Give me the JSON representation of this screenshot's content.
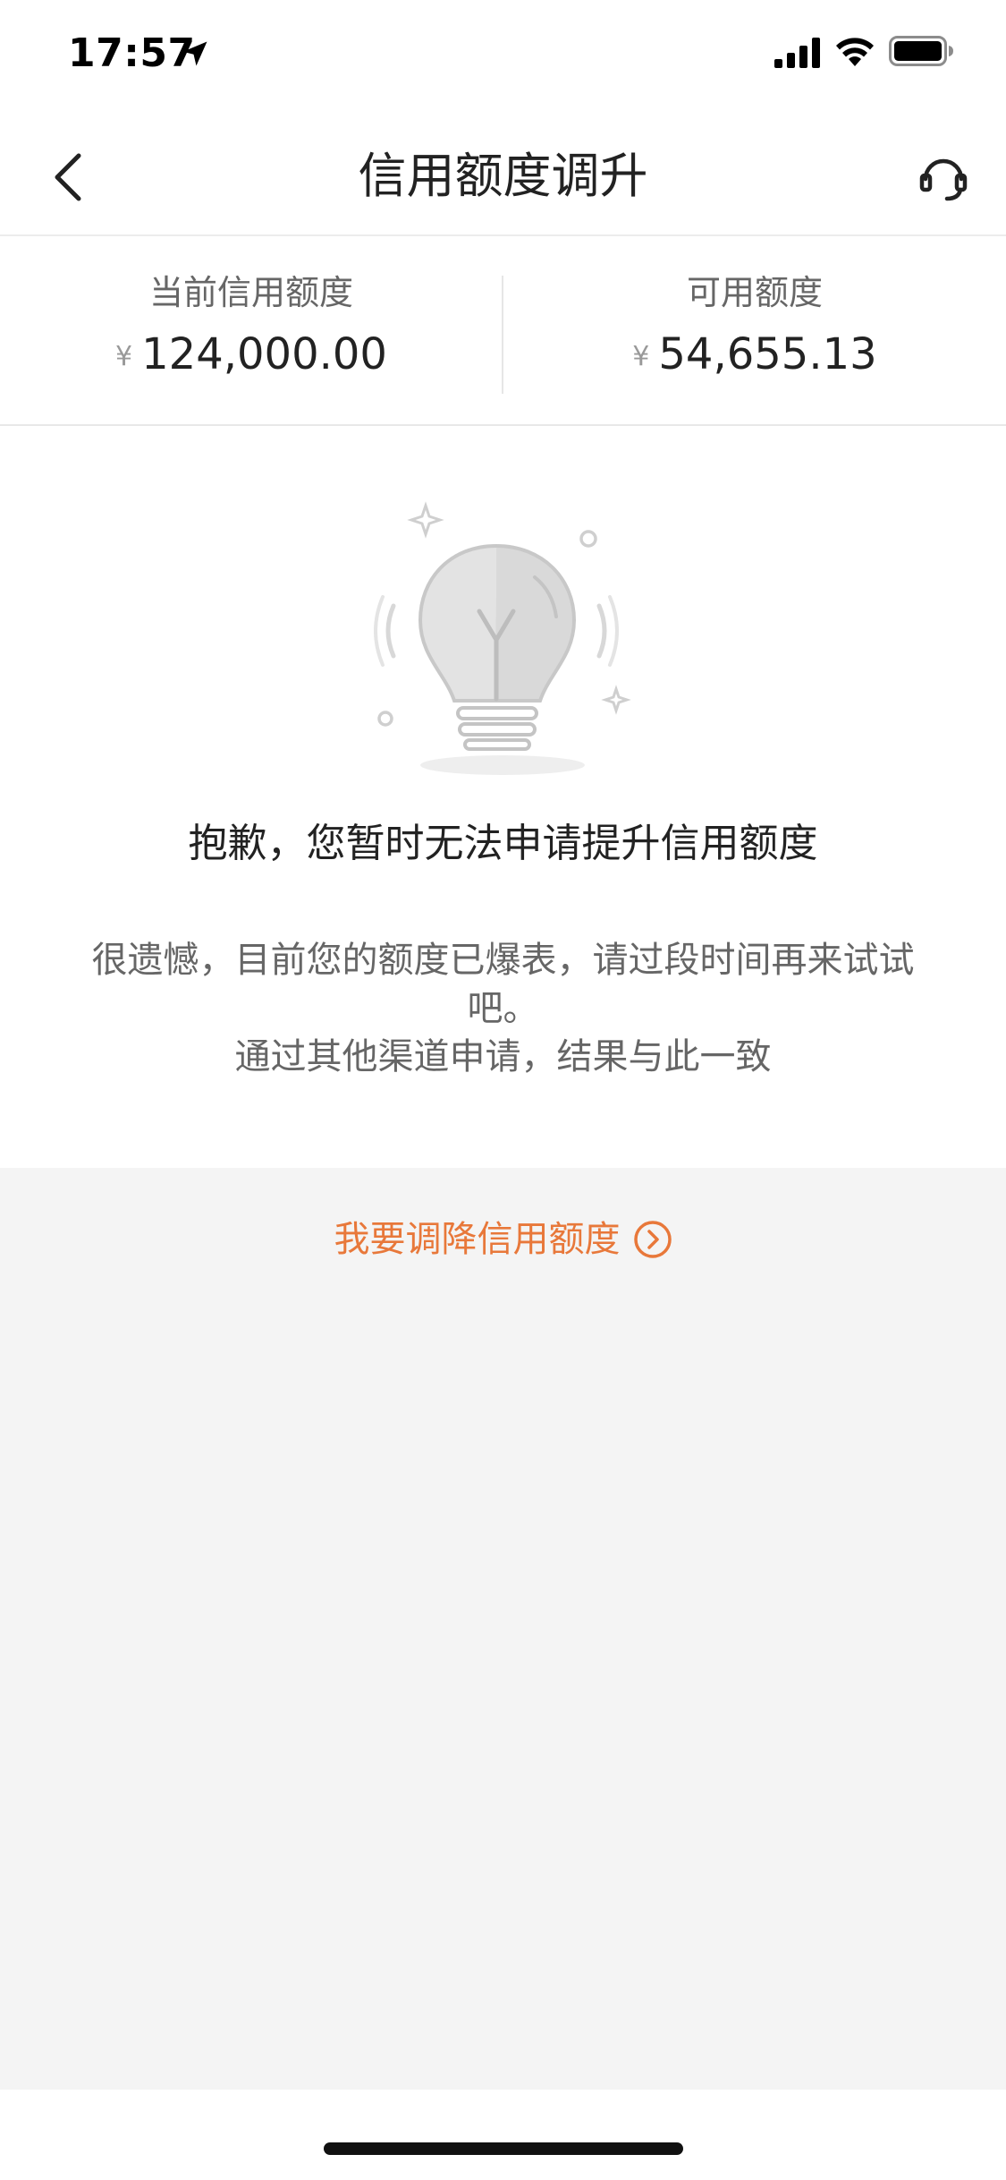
{
  "status_bar": {
    "time": "17:57",
    "icons": [
      "location-arrow-icon",
      "cellular-signal-icon",
      "wifi-icon",
      "battery-icon"
    ]
  },
  "nav": {
    "title": "信用额度调升",
    "back_icon": "chevron-left-icon",
    "support_icon": "headset-icon"
  },
  "credit": {
    "current": {
      "label": "当前信用额度",
      "currency": "¥",
      "amount": "124,000.00"
    },
    "available": {
      "label": "可用额度",
      "currency": "¥",
      "amount": "54,655.13"
    }
  },
  "notice": {
    "illustration_icon": "lightbulb-icon",
    "title": "抱歉，您暂时无法申请提升信用额度",
    "desc_line1": "很遗憾，目前您的额度已爆表，请过段时间再来试试",
    "desc_line2": "吧。",
    "desc_line3": "通过其他渠道申请，结果与此一致"
  },
  "reduce": {
    "label": "我要调降信用额度",
    "icon": "circle-chevron-right-icon"
  },
  "colors": {
    "accent": "#e8783a",
    "background_gray": "#f4f4f4",
    "text_primary": "#222222",
    "text_secondary": "#666666"
  }
}
